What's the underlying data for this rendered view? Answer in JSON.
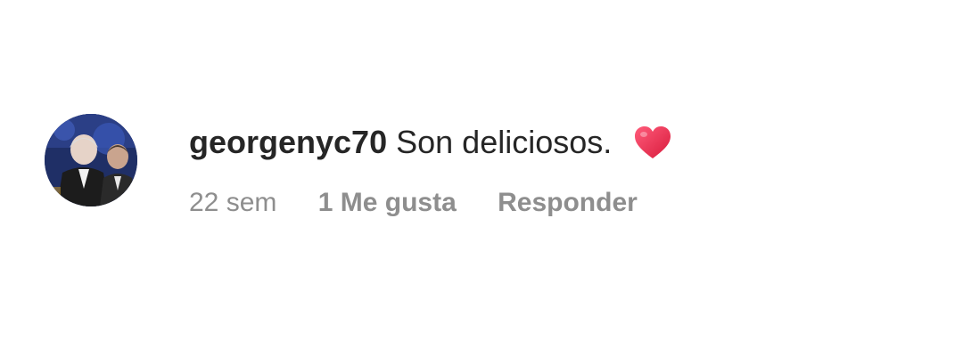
{
  "comment": {
    "username": "georgenyc70",
    "text": "Son deliciosos.",
    "emoji": "heart-icon",
    "time": "22 sem",
    "likes": "1 Me gusta",
    "reply_label": "Responder"
  },
  "colors": {
    "text": "#262626",
    "secondary": "#8e8e8e",
    "heart": "#e8344e"
  }
}
